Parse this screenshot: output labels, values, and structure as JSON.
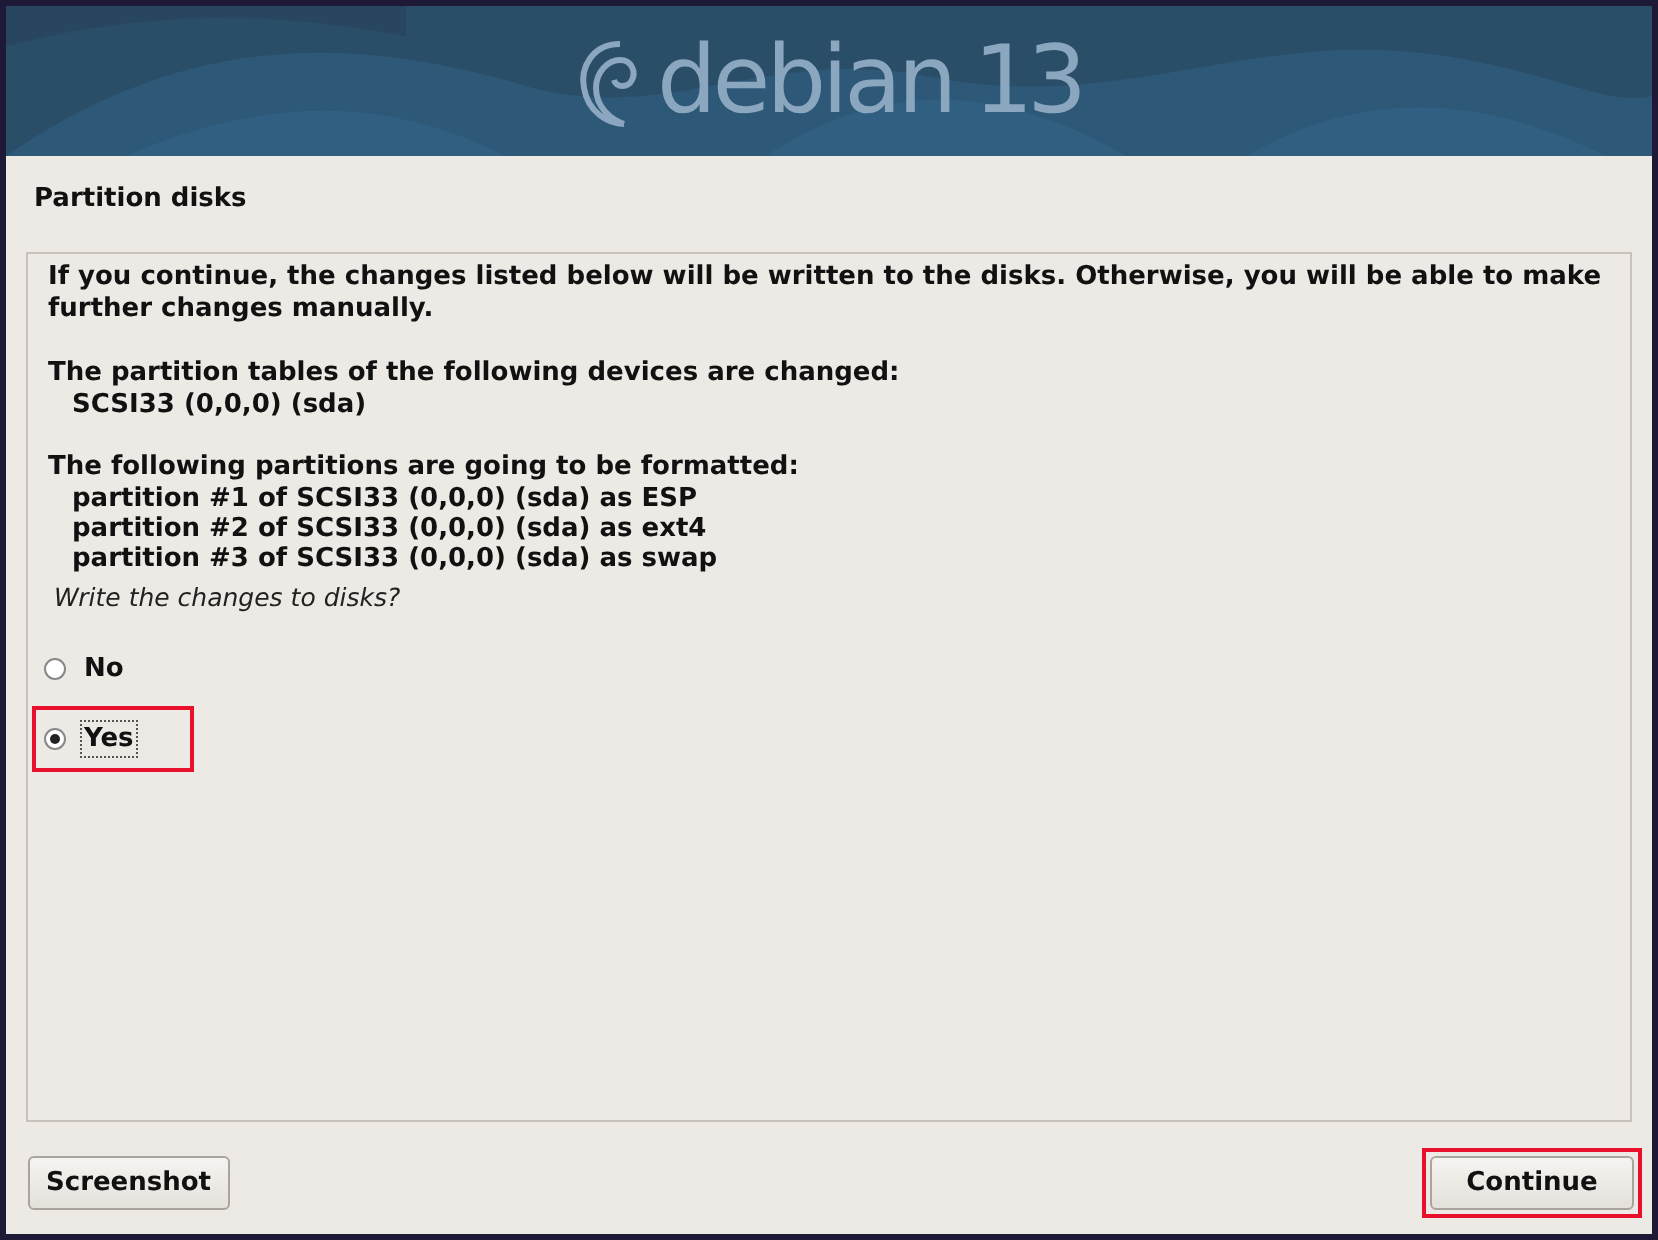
{
  "banner": {
    "logo_text": "debian",
    "version": "13"
  },
  "page_title": "Partition disks",
  "message": {
    "intro": "If you continue, the changes listed below will be written to the disks. Otherwise, you will be able to make further changes manually.",
    "sections": [
      {
        "heading": "The partition tables of the following devices are changed:",
        "items": [
          "SCSI33 (0,0,0) (sda)"
        ]
      },
      {
        "heading": "The following partitions are going to be formatted:",
        "items": [
          "partition #1 of SCSI33 (0,0,0) (sda) as ESP",
          "partition #2 of SCSI33 (0,0,0) (sda) as ext4",
          "partition #3 of SCSI33 (0,0,0) (sda) as swap"
        ]
      }
    ]
  },
  "question": "Write the changes to disks?",
  "options": [
    {
      "label": "No",
      "selected": false,
      "focused": false,
      "highlighted": false
    },
    {
      "label": "Yes",
      "selected": true,
      "focused": true,
      "highlighted": true
    }
  ],
  "buttons": [
    {
      "label": "Screenshot",
      "highlighted": false
    },
    {
      "label": "Continue",
      "highlighted": true
    }
  ]
}
